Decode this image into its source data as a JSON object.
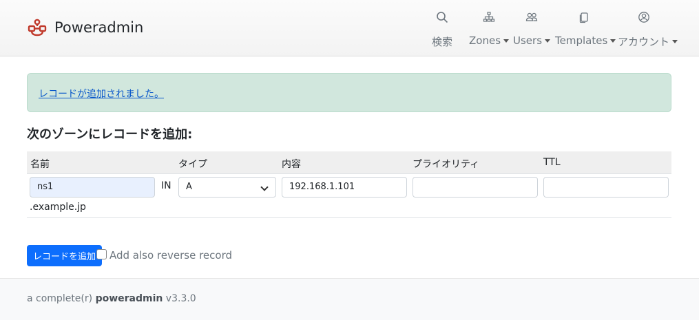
{
  "brand": {
    "name": "Poweradmin",
    "logo_color": "#c0392b"
  },
  "nav": {
    "search": {
      "label": "検索",
      "icon": "search-icon"
    },
    "zones": {
      "label": "Zones",
      "icon": "sitemap-icon"
    },
    "users": {
      "label": "Users",
      "icon": "people-icon"
    },
    "templates": {
      "label": "Templates",
      "icon": "copy-icon"
    },
    "account": {
      "label": "アカウント",
      "icon": "person-circle-icon"
    }
  },
  "alert": {
    "message": "レコードが追加されました。",
    "color": "#d1e7dd"
  },
  "heading": "次のゾーンにレコードを追加:",
  "table": {
    "columns": {
      "name": "名前",
      "type": "タイプ",
      "content": "内容",
      "priority": "プライオリティ",
      "ttl": "TTL"
    },
    "row": {
      "name": "ns1",
      "in": "IN",
      "zone_suffix": ".example.jp",
      "type": "A",
      "content": "192.168.1.101",
      "priority": "",
      "ttl": ""
    }
  },
  "form": {
    "submit_label": "レコードを追加",
    "reverse_label": "Add also reverse record",
    "reverse_checked": false,
    "accent": "#0d6efd"
  },
  "footer": {
    "prefix": "a complete(r) ",
    "product": "poweradmin",
    "version": " v3.3.0"
  }
}
